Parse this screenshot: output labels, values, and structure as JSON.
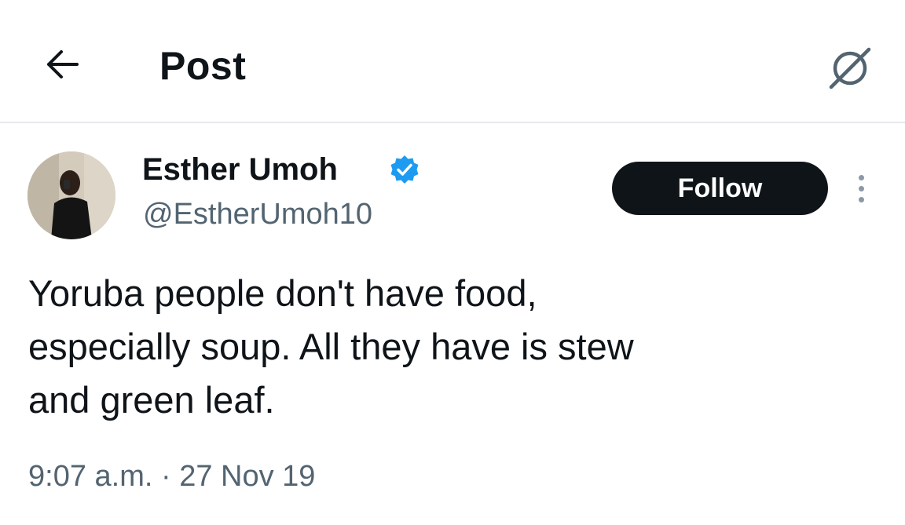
{
  "header": {
    "title": "Post",
    "back_icon": "arrow-left-icon",
    "grok_icon": "grok-icon"
  },
  "author": {
    "name": "Esther Umoh",
    "handle": "@EstherUmoh10",
    "verified": true,
    "verified_color": "#1d9bf0",
    "avatar_icon": "avatar"
  },
  "follow_button": {
    "label": "Follow",
    "background": "#0f1419",
    "color": "#ffffff"
  },
  "more_icon": "more-vertical-icon",
  "post": {
    "text": "Yoruba people don't have food,\nespecially soup. All they have is stew\nand green leaf.",
    "timestamp": "9:07 a.m. · 27 Nov 19"
  }
}
